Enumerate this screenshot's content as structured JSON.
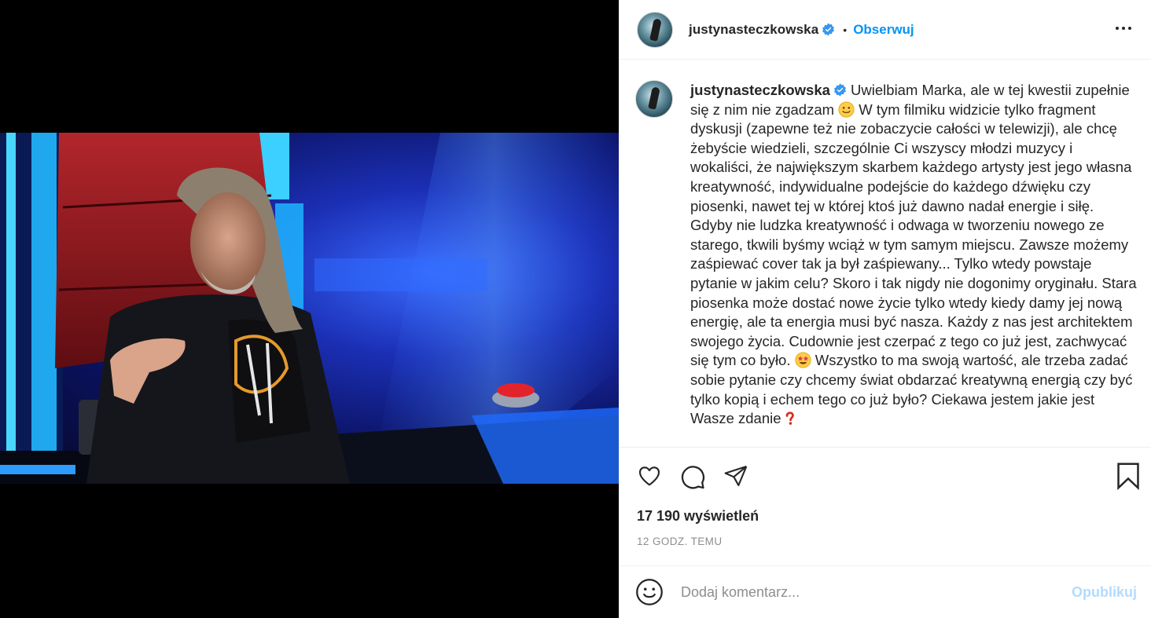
{
  "post": {
    "username": "justynasteczkowska",
    "follow_label": "Obserwuj",
    "separator": "•"
  },
  "caption": {
    "username": "justynasteczkowska",
    "part1": " Uwielbiam Marka, ale w tej kwestii zupełnie się z nim nie zgadzam ",
    "part2": " W tym filmiku widzicie tylko fragment dyskusji (zapewne też nie zobaczycie całości w telewizji), ale chcę żebyście wiedzieli, szczególnie Ci wszyscy młodzi muzycy i wokaliści, że największym skarbem każdego artysty jest jego własna kreatywność, indywidualne podejście do każdego dźwięku czy piosenki, nawet tej w której ktoś już dawno nadał energie i siłę. Gdyby nie ludzka kreatywność i odwaga w tworzeniu nowego ze starego, tkwili byśmy wciąż w tym samym miejscu. Zawsze możemy zaśpiewać cover tak ja był zaśpiewany... Tylko wtedy powstaje pytanie w jakim celu? Skoro i tak nigdy nie dogonimy oryginału. Stara piosenka może dostać nowe życie tylko wtedy kiedy damy jej nową energię, ale ta energia musi być nasza. Każdy z nas jest architektem swojego życia. Cudownie jest czerpać z tego co już jest, zachwycać się tym co było. ",
    "part3": " Wszystko to ma swoją wartość, ale trzeba zadać sobie pytanie czy chcemy świat obdarzać kreatywną energią czy być tylko kopią i echem tego co już było? Ciekawa jestem jakie jest Wasze zdanie",
    "emojis": [
      "slightly-smiling-face",
      "star-struck-face",
      "red-question-mark"
    ]
  },
  "stats": {
    "views": "17 190 wyświetleń",
    "time": "12 GODZ. TEMU"
  },
  "comment": {
    "placeholder": "Dodaj komentarz...",
    "publish_label": "Opublikuj"
  },
  "icons": {
    "like": "heart-icon",
    "comment": "comment-icon",
    "share": "send-icon",
    "save": "bookmark-icon",
    "more": "more-options-icon",
    "emoji": "emoji-icon",
    "verified": "verified-badge-icon"
  },
  "colors": {
    "accent": "#0095f6",
    "publish_disabled": "#b3dbff",
    "text": "#262626",
    "muted": "#8e8e8e",
    "verified": "#3897f0"
  }
}
